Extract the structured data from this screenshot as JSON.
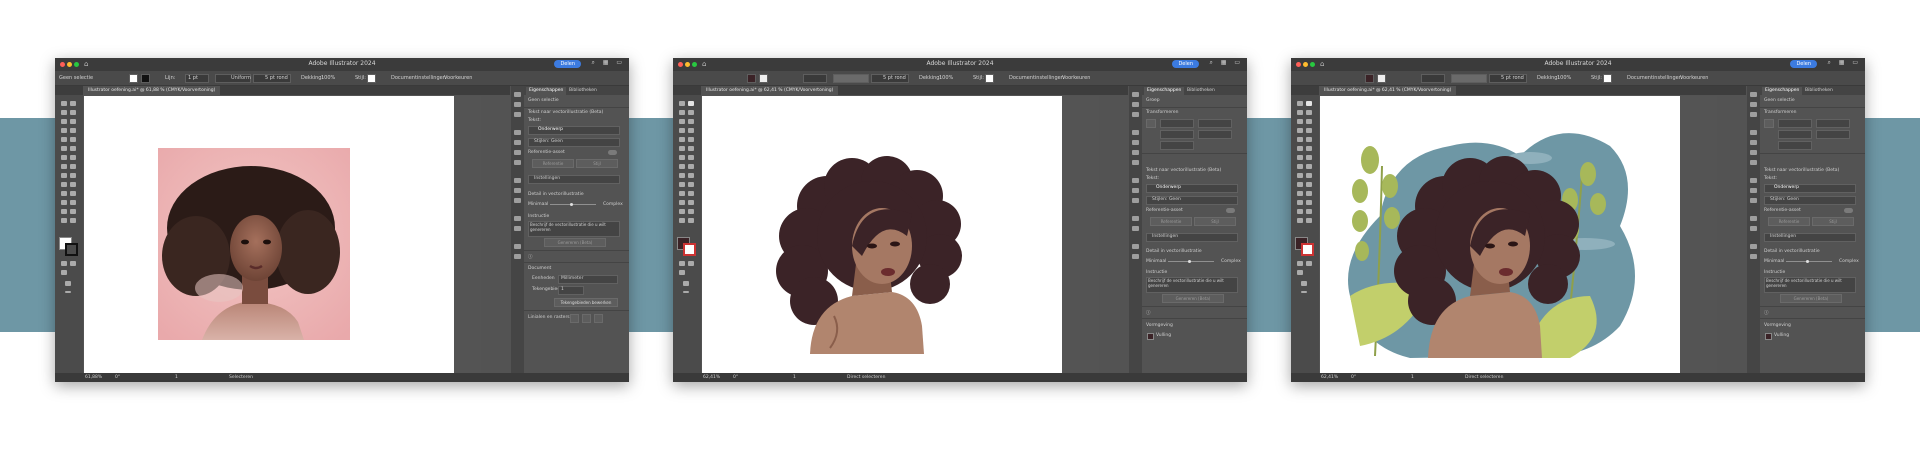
{
  "app": {
    "title": "Adobe Illustrator 2024",
    "share_label": "Delen",
    "doc_tab": "Illustrator oefening.ai*",
    "colors": {
      "background_band": "#6e97a5",
      "share_blue": "#3c7be0",
      "dark_brown": "#3b2327",
      "skin": "#a57863"
    }
  },
  "windows": [
    {
      "doc_tab": "Illustrator oefening.ai* @ 61,88 % (CMYK/Voorvertoning)",
      "control": {
        "selection": "Geen selectie",
        "stroke_label": "Lijn:",
        "stroke_value": "1 pt",
        "profile_label": "Uniform",
        "brush_label": "5 pt rond",
        "opacity_label": "Dekking:",
        "opacity_value": "100%",
        "style_label": "Stijl:",
        "doc_settings": "Documentinstellingen",
        "prefs": "Voorkeuren"
      },
      "panel": {
        "tabs": [
          "Eigenschappen",
          "Bibliotheken"
        ],
        "no_selection": "Geen selectie",
        "section_title": "Tekst naar vectorillustratie (Beta)",
        "type_label": "Tekst:",
        "type_value": "Onderwerp",
        "styles_label": "Stijlen: Geen",
        "reference_label": "Referentie-asset",
        "btn_reference": "Referentie",
        "btn_match": "Stijl",
        "settings_label": "Instellingen",
        "detail_label": "Detail in vectorillustratie",
        "detail_min": "Minimaal",
        "detail_max": "Complex",
        "detail_level": 0.45,
        "prompt_label": "Instructie",
        "prompt_placeholder": "Beschrijf de vectorillustratie die u wilt genereren",
        "generate_button": "Genereren (Beta)",
        "document_label": "Document",
        "units_label": "Eenheden",
        "units_value": "Millimeter",
        "artboard_label": "Tekengebied",
        "artboard_value": "1",
        "edit_artboards": "Tekengebieden bewerken",
        "rulers_label": "Linialen en rasters"
      },
      "status": {
        "zoom": "61,88%",
        "angle": "0°",
        "page": "1",
        "tool": "Selecteren"
      }
    },
    {
      "doc_tab": "Illustrator oefening.ai* @ 62,41 % (CMYK/Voorvertoning)",
      "control": {
        "brush_label": "5 pt rond",
        "opacity_label": "Dekking:",
        "opacity_value": "100%",
        "style_label": "Stijl:",
        "doc_settings": "Documentinstellingen",
        "prefs": "Voorkeuren"
      },
      "panel": {
        "tabs": [
          "Eigenschappen",
          "Bibliotheken"
        ],
        "group": "Groep",
        "transform_label": "Transformeren",
        "section_title": "Tekst naar vectorillustratie (Beta)",
        "type_label": "Tekst:",
        "type_value": "Onderwerp",
        "styles_label": "Stijlen: Geen",
        "reference_label": "Referentie-asset",
        "btn_reference": "Referentie",
        "btn_match": "Stijl",
        "settings_label": "Instellingen",
        "detail_label": "Detail in vectorillustratie",
        "detail_min": "Minimaal",
        "detail_max": "Complex",
        "detail_level": 0.45,
        "prompt_label": "Instructie",
        "prompt_placeholder": "Beschrijf de vectorillustratie die u wilt genereren",
        "generate_button": "Genereren (Beta)",
        "appearance_label": "Vormgeving",
        "fill_label": "Vulling"
      },
      "status": {
        "zoom": "62,41%",
        "angle": "0°",
        "page": "1",
        "tool": "Direct selecteren"
      }
    },
    {
      "doc_tab": "Illustrator oefening.ai* @ 62,41 % (CMYK/Voorvertoning)",
      "control": {
        "brush_label": "5 pt rond",
        "opacity_label": "Dekking:",
        "opacity_value": "100%",
        "style_label": "Stijl:",
        "doc_settings": "Documentinstellingen",
        "prefs": "Voorkeuren"
      },
      "panel": {
        "tabs": [
          "Eigenschappen",
          "Bibliotheken"
        ],
        "group": "Geen selectie",
        "transform_label": "Transformeren",
        "section_title": "Tekst naar vectorillustratie (Beta)",
        "type_label": "Tekst:",
        "type_value": "Onderwerp",
        "styles_label": "Stijlen: Geen",
        "reference_label": "Referentie-asset",
        "btn_reference": "Referentie",
        "btn_match": "Stijl",
        "settings_label": "Instellingen",
        "detail_label": "Detail in vectorillustratie",
        "detail_min": "Minimaal",
        "detail_max": "Complex",
        "detail_level": 0.45,
        "prompt_label": "Instructie",
        "prompt_placeholder": "Beschrijf de vectorillustratie die u wilt genereren",
        "generate_button": "Genereren (Beta)",
        "appearance_label": "Vormgeving",
        "fill_label": "Vulling"
      },
      "status": {
        "zoom": "62,41%",
        "angle": "0°",
        "page": "1",
        "tool": "Direct selecteren"
      }
    }
  ]
}
